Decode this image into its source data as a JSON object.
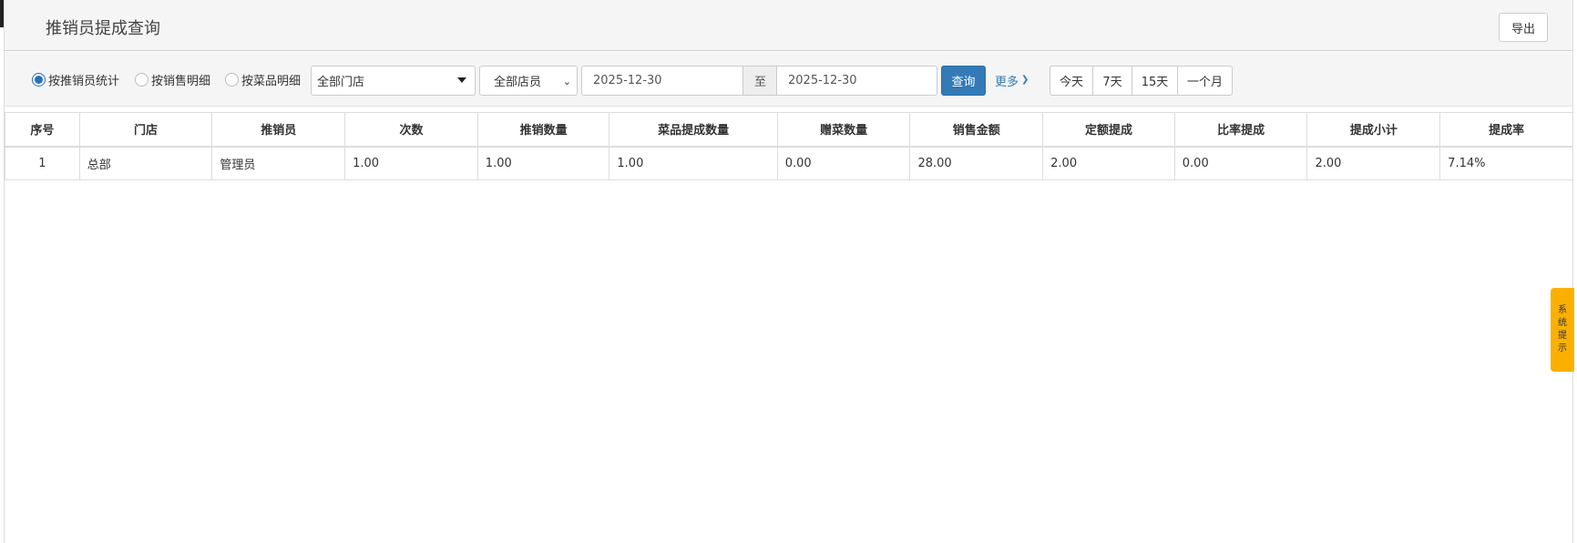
{
  "header": {
    "title": "推销员提成查询",
    "export_label": "导出"
  },
  "filters": {
    "radios": [
      {
        "label": "按推销员统计",
        "checked": true
      },
      {
        "label": "按销售明细",
        "checked": false
      },
      {
        "label": "按菜品明细",
        "checked": false
      }
    ],
    "store_select": "全部门店",
    "staff_select": "全部店员",
    "date_from": "2025-12-30",
    "date_sep": "至",
    "date_to": "2025-12-30",
    "query_label": "查询",
    "more_label": "更多",
    "ranges": [
      "今天",
      "7天",
      "15天",
      "一个月"
    ]
  },
  "table": {
    "columns": [
      "序号",
      "门店",
      "推销员",
      "次数",
      "推销数量",
      "菜品提成数量",
      "赠菜数量",
      "销售金额",
      "定额提成",
      "比率提成",
      "提成小计",
      "提成率"
    ],
    "rows": [
      [
        "1",
        "总部",
        "管理员",
        "1.00",
        "1.00",
        "1.00",
        "0.00",
        "28.00",
        "2.00",
        "0.00",
        "2.00",
        "7.14%"
      ]
    ]
  },
  "side_tab": {
    "text": [
      "系",
      "统",
      "提",
      "示"
    ]
  },
  "colors": {
    "primary": "#337ab7",
    "side_tab": "#fbb000"
  }
}
